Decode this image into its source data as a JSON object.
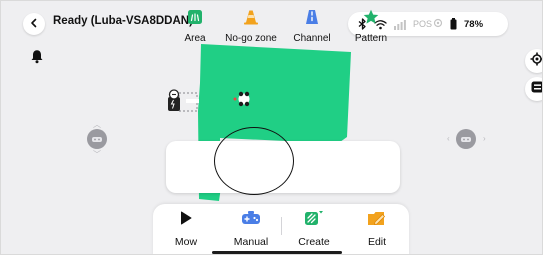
{
  "header": {
    "back_icon": "chevron-left-icon",
    "title": "Ready  (Luba-VSA8DDAN)"
  },
  "status": {
    "bluetooth_icon": "bluetooth-icon",
    "wifi_icon": "wifi-icon",
    "cellular_icon": "cellular-signal-icon",
    "pos_label": "POS",
    "battery_icon": "battery-icon",
    "battery_text": "78%"
  },
  "map": {
    "area_color": "#20cf85",
    "bell_icon": "bell-icon",
    "locate_icon": "crosshair-icon",
    "list_icon": "list-icon",
    "base_station_icon": "charging-station-icon",
    "mower_icon": "mower-icon",
    "joystick_left_icon": "joystick-left-icon",
    "joystick_right_icon": "joystick-right-icon"
  },
  "create_panel": {
    "options": [
      {
        "label": "Area",
        "icon": "grass-area-icon",
        "color": "#21b26b"
      },
      {
        "label": "No-go zone",
        "icon": "traffic-cone-icon",
        "color": "#f2a21d"
      },
      {
        "label": "Channel",
        "icon": "road-channel-icon",
        "color": "#4a7ee6"
      },
      {
        "label": "Pattern",
        "icon": "star-pattern-icon",
        "color": "#21b26b"
      }
    ],
    "highlight_color": "#111111"
  },
  "bottom_bar": {
    "buttons": [
      {
        "label": "Mow",
        "icon": "play-icon"
      },
      {
        "label": "Manual",
        "icon": "gamepad-icon"
      },
      {
        "label": "Create",
        "icon": "create-zone-icon"
      },
      {
        "label": "Edit",
        "icon": "edit-folder-icon"
      }
    ]
  }
}
